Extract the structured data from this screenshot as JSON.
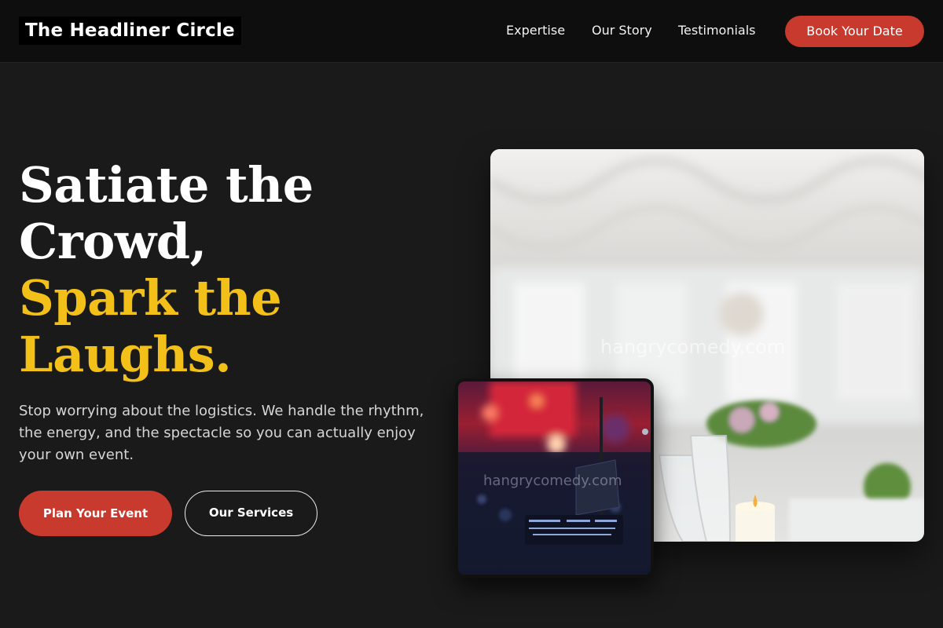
{
  "brand": {
    "name": "The Headliner Circle"
  },
  "nav": {
    "items": [
      {
        "label": "Expertise"
      },
      {
        "label": "Our Story"
      },
      {
        "label": "Testimonials"
      }
    ],
    "cta_label": "Book Your Date"
  },
  "hero": {
    "headline_white": [
      "Satiate the",
      "Crowd,"
    ],
    "headline_gold": [
      "Spark the",
      "Laughs."
    ],
    "subtext": "Stop worrying about the logistics. We handle the rhythm, the energy, and the spectacle so you can actually enjoy your own event.",
    "primary_button": "Plan Your Event",
    "secondary_button": "Our Services"
  },
  "images": {
    "watermark": "hangrycomedy.com",
    "large_alt": "event-tent-table-setting",
    "small_alt": "concert-sound-desk"
  },
  "colors": {
    "background": "#1a1a1a",
    "header": "#0e0e0e",
    "accent_red": "#c73a2d",
    "accent_gold": "#f2c018"
  }
}
